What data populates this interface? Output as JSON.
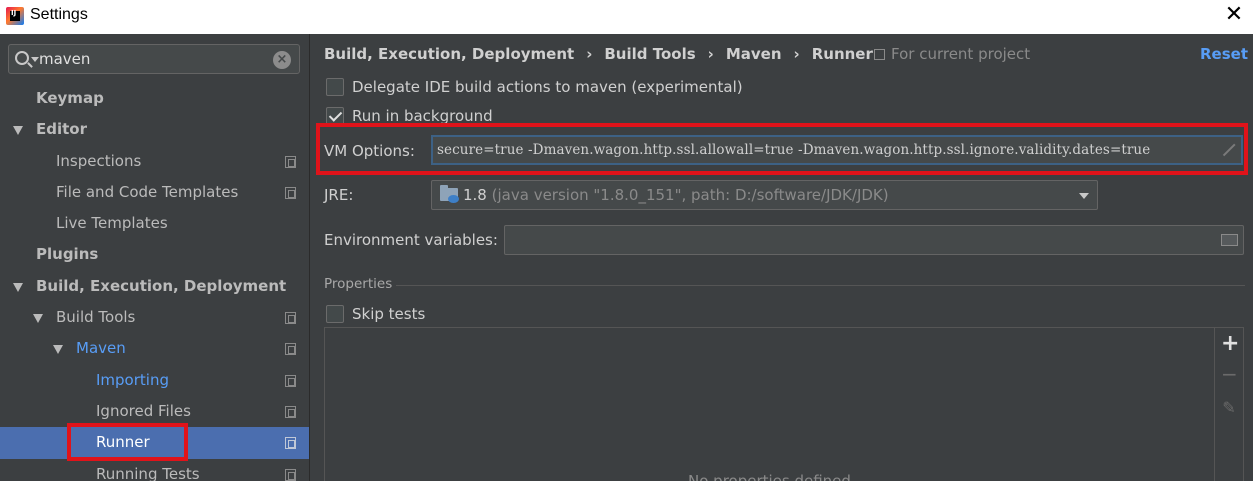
{
  "window": {
    "title": "Settings",
    "app_icon_text": "IJ"
  },
  "sidebar": {
    "search": {
      "value": "maven",
      "placeholder": ""
    },
    "items": [
      {
        "label": "Keymap"
      },
      {
        "label": "Editor"
      },
      {
        "label": "Inspections"
      },
      {
        "label": "File and Code Templates"
      },
      {
        "label": "Live Templates"
      },
      {
        "label": "Plugins"
      },
      {
        "label": "Build, Execution, Deployment"
      },
      {
        "label": "Build Tools"
      },
      {
        "label": "Maven"
      },
      {
        "label": "Importing"
      },
      {
        "label": "Ignored Files"
      },
      {
        "label": "Runner"
      },
      {
        "label": "Running Tests"
      }
    ]
  },
  "main": {
    "breadcrumb": [
      "Build, Execution, Deployment",
      "Build Tools",
      "Maven",
      "Runner"
    ],
    "breadcrumb_sep": "›",
    "for_current_project": "For current project",
    "reset_label": "Reset",
    "delegate_checkbox": {
      "label": "Delegate IDE build actions to maven (experimental)",
      "checked": false
    },
    "background_checkbox": {
      "label": "Run in background",
      "checked": true
    },
    "vm_options": {
      "label": "VM Options:",
      "value": "secure=true -Dmaven.wagon.http.ssl.allowall=true -Dmaven.wagon.http.ssl.ignore.validity.dates=true"
    },
    "jre": {
      "label": "JRE:",
      "version": "1.8",
      "detail": "(java version \"1.8.0_151\", path: D:/software/JDK/JDK)"
    },
    "env_vars": {
      "label": "Environment variables:",
      "value": ""
    },
    "properties": {
      "section_label": "Properties",
      "skip_tests_label": "Skip tests",
      "skip_tests_checked": false,
      "empty_text": "No properties defined"
    }
  },
  "colors": {
    "background": "#3c3f41",
    "selection": "#4b6eaf",
    "link": "#589df6",
    "highlight_box": "#e0131a"
  }
}
